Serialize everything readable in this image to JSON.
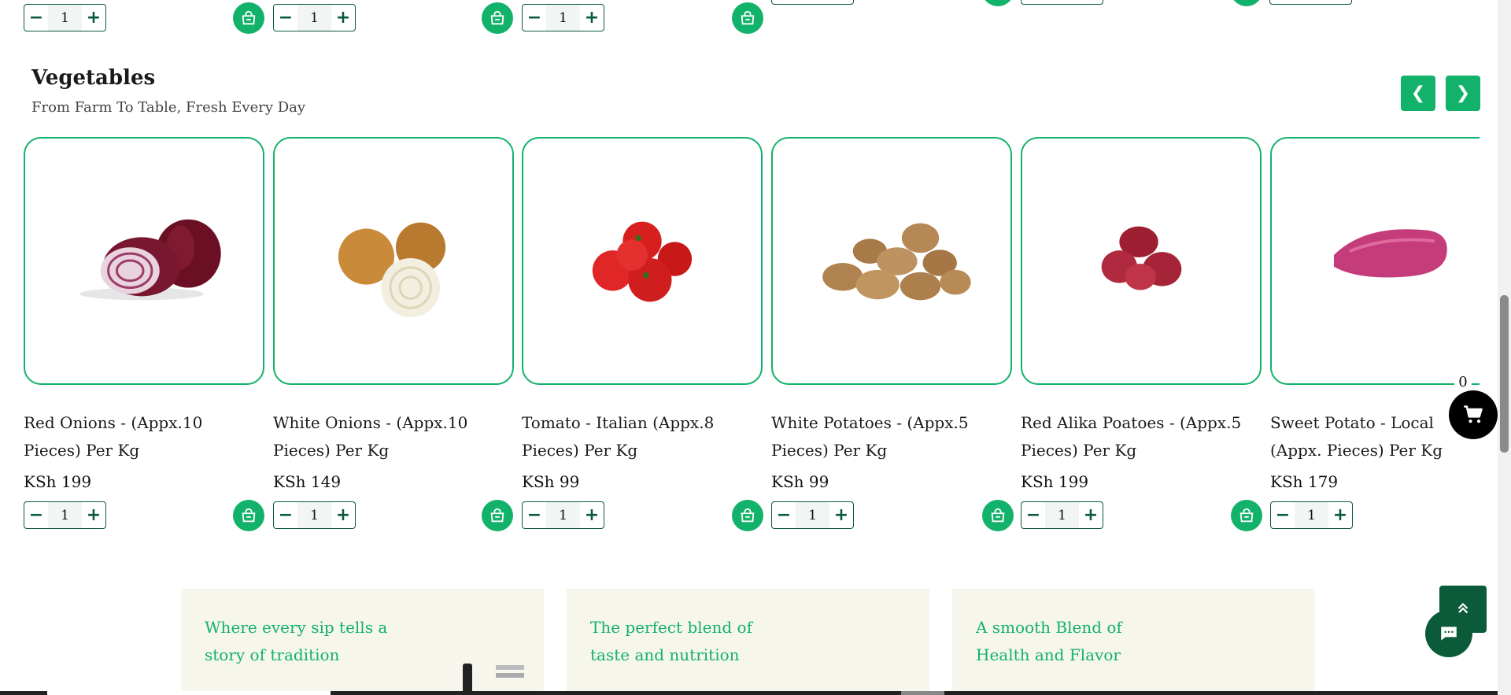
{
  "top_row": {
    "qty_values": [
      "1",
      "1",
      "1"
    ]
  },
  "section": {
    "title": "Vegetables",
    "subtitle": "From Farm To Table, Fresh Every Day",
    "prev_icon": "❮",
    "next_icon": "❯"
  },
  "products": [
    {
      "name": "Red Onions - (Appx.10 Pieces) Per Kg",
      "price": "KSh 199",
      "qty": "1"
    },
    {
      "name": "White Onions - (Appx.10 Pieces) Per Kg",
      "price": "KSh 149",
      "qty": "1"
    },
    {
      "name": "Tomato - Italian (Appx.8 Pieces) Per Kg",
      "price": "KSh 99",
      "qty": "1"
    },
    {
      "name": "White Potatoes - (Appx.5 Pieces) Per Kg",
      "price": "KSh 99",
      "qty": "1"
    },
    {
      "name": "Red Alika Poatoes - (Appx.5 Pieces) Per Kg",
      "price": "KSh 199",
      "qty": "1"
    },
    {
      "name": "Sweet Potato - Local (Appx. Pieces) Per Kg",
      "price": "KSh 179",
      "qty": "1"
    }
  ],
  "stepper": {
    "minus": "−",
    "plus": "+"
  },
  "cart": {
    "count": "0"
  },
  "promos": [
    {
      "text": "Where every sip tells a story of tradition"
    },
    {
      "text": "The perfect blend of taste and nutrition"
    },
    {
      "text": "A smooth Blend of Health and Flavor"
    }
  ],
  "colors": {
    "accent": "#12b26a",
    "dark_green": "#0b5a3a",
    "promo_bg": "#f6f6ec"
  }
}
